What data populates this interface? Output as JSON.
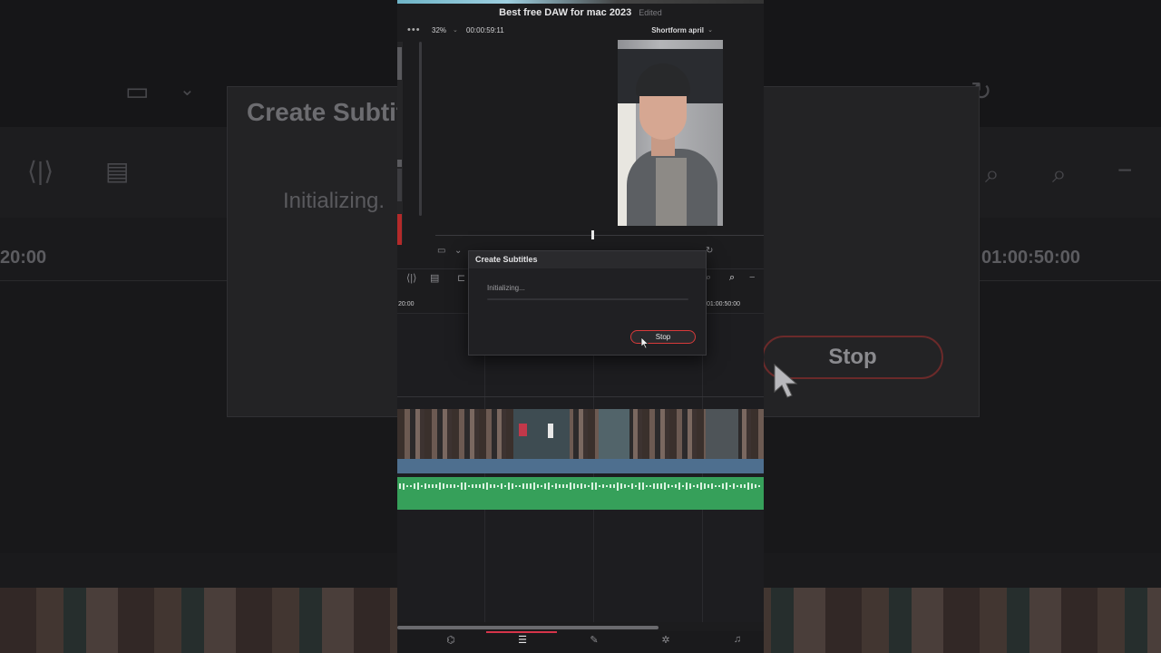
{
  "window": {
    "project_title": "Best free DAW for mac 2023",
    "edited_label": "Edited"
  },
  "viewer": {
    "menu_icon": "more-dots-icon",
    "zoom": "32%",
    "timecode": "00:00:59:11",
    "timeline_name": "Shortform april"
  },
  "timeline": {
    "ruler_left": "20:00",
    "ruler_right": "01:00:50:00"
  },
  "dialog": {
    "title": "Create Subtitles",
    "status": "Initializing...",
    "progress": 0.0,
    "stop_label": "Stop"
  },
  "background": {
    "title_fragment": "Create Subtit",
    "status_fragment": "Initializing.",
    "stop_label": "Stop",
    "ruler_left": "20:00",
    "ruler_right": "01:00:50:00"
  },
  "page_nav": {
    "pages": [
      {
        "name": "media-page-icon",
        "glyph": "⌬"
      },
      {
        "name": "edit-page-icon",
        "glyph": "☰"
      },
      {
        "name": "color-page-icon",
        "glyph": "✎"
      },
      {
        "name": "fx-page-icon",
        "glyph": "✲"
      },
      {
        "name": "audio-page-icon",
        "glyph": "♫"
      }
    ],
    "active_index": 1
  },
  "colors": {
    "accent_red": "#d83a3a",
    "audio_green": "#36a05a",
    "video_blue": "#4e6f8f"
  }
}
